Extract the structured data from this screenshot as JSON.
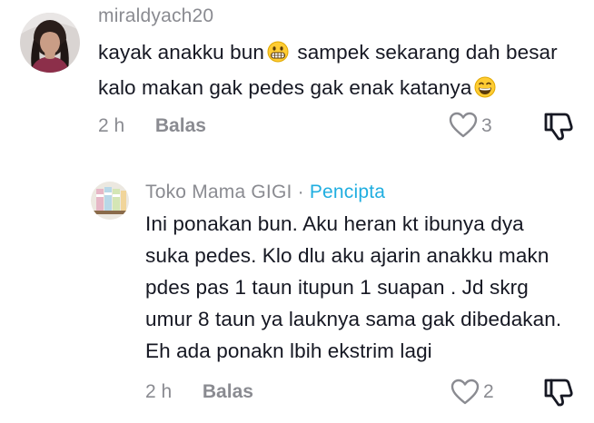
{
  "comments": [
    {
      "username": "miraldyach20",
      "text_lines": [
        "kayak anakku bun",
        "sampek sekarang dah besar",
        "kalo makan gak pedes gak enak katanya"
      ],
      "emojis": [
        "grimacing-face",
        "grinning-face"
      ],
      "time": "2 h",
      "reply_label": "Balas",
      "like_count": "3"
    },
    {
      "username": "Toko Mama GIGI",
      "separator": "·",
      "badge": "Pencipta",
      "text_lines": [
        "Ini ponakan bun. Aku heran kt ibunya dya",
        "suka pedes. Klo dlu aku ajarin anakku makn",
        "pdes pas 1 taun itupun 1 suapan . Jd skrg",
        "umur 8 taun ya lauknya sama gak dibedakan.",
        "Eh ada ponakn lbih ekstrim lagi"
      ],
      "time": "2 h",
      "reply_label": "Balas",
      "like_count": "2"
    }
  ],
  "colors": {
    "text": "#161823",
    "muted": "#8a8b91",
    "creator_badge": "#20aee0"
  },
  "icons": [
    "heart-outline-icon",
    "thumbs-down-icon"
  ]
}
